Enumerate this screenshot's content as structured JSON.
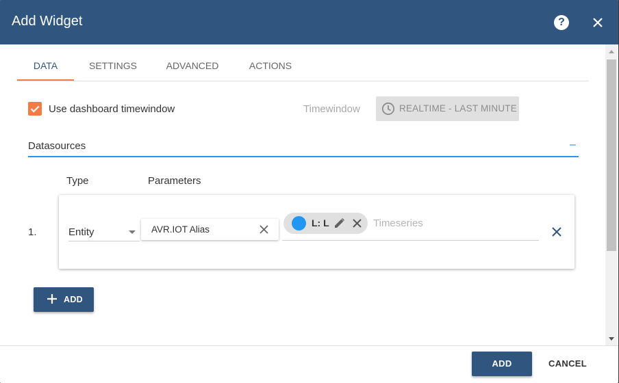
{
  "dialog": {
    "title": "Add Widget"
  },
  "tabs": [
    {
      "label": "DATA",
      "active": true
    },
    {
      "label": "SETTINGS",
      "active": false
    },
    {
      "label": "ADVANCED",
      "active": false
    },
    {
      "label": "ACTIONS",
      "active": false
    }
  ],
  "timewindow": {
    "use_dashboard_label": "Use dashboard timewindow",
    "use_dashboard_checked": true,
    "label": "Timewindow",
    "value": "REALTIME - LAST MINUTE"
  },
  "datasources": {
    "title": "Datasources",
    "collapse_symbol": "–",
    "columns": {
      "type": "Type",
      "parameters": "Parameters"
    },
    "items": [
      {
        "index": "1.",
        "type": "Entity",
        "alias": "AVR.IOT Alias",
        "timeseries_key": "L: L",
        "timeseries_color": "#2196f3",
        "timeseries_placeholder": "Timeseries"
      }
    ],
    "add_label": "ADD"
  },
  "footer": {
    "add_label": "ADD",
    "cancel_label": "CANCEL"
  },
  "colors": {
    "primary": "#305680",
    "accent": "#f47b46",
    "link": "#2196f3"
  }
}
